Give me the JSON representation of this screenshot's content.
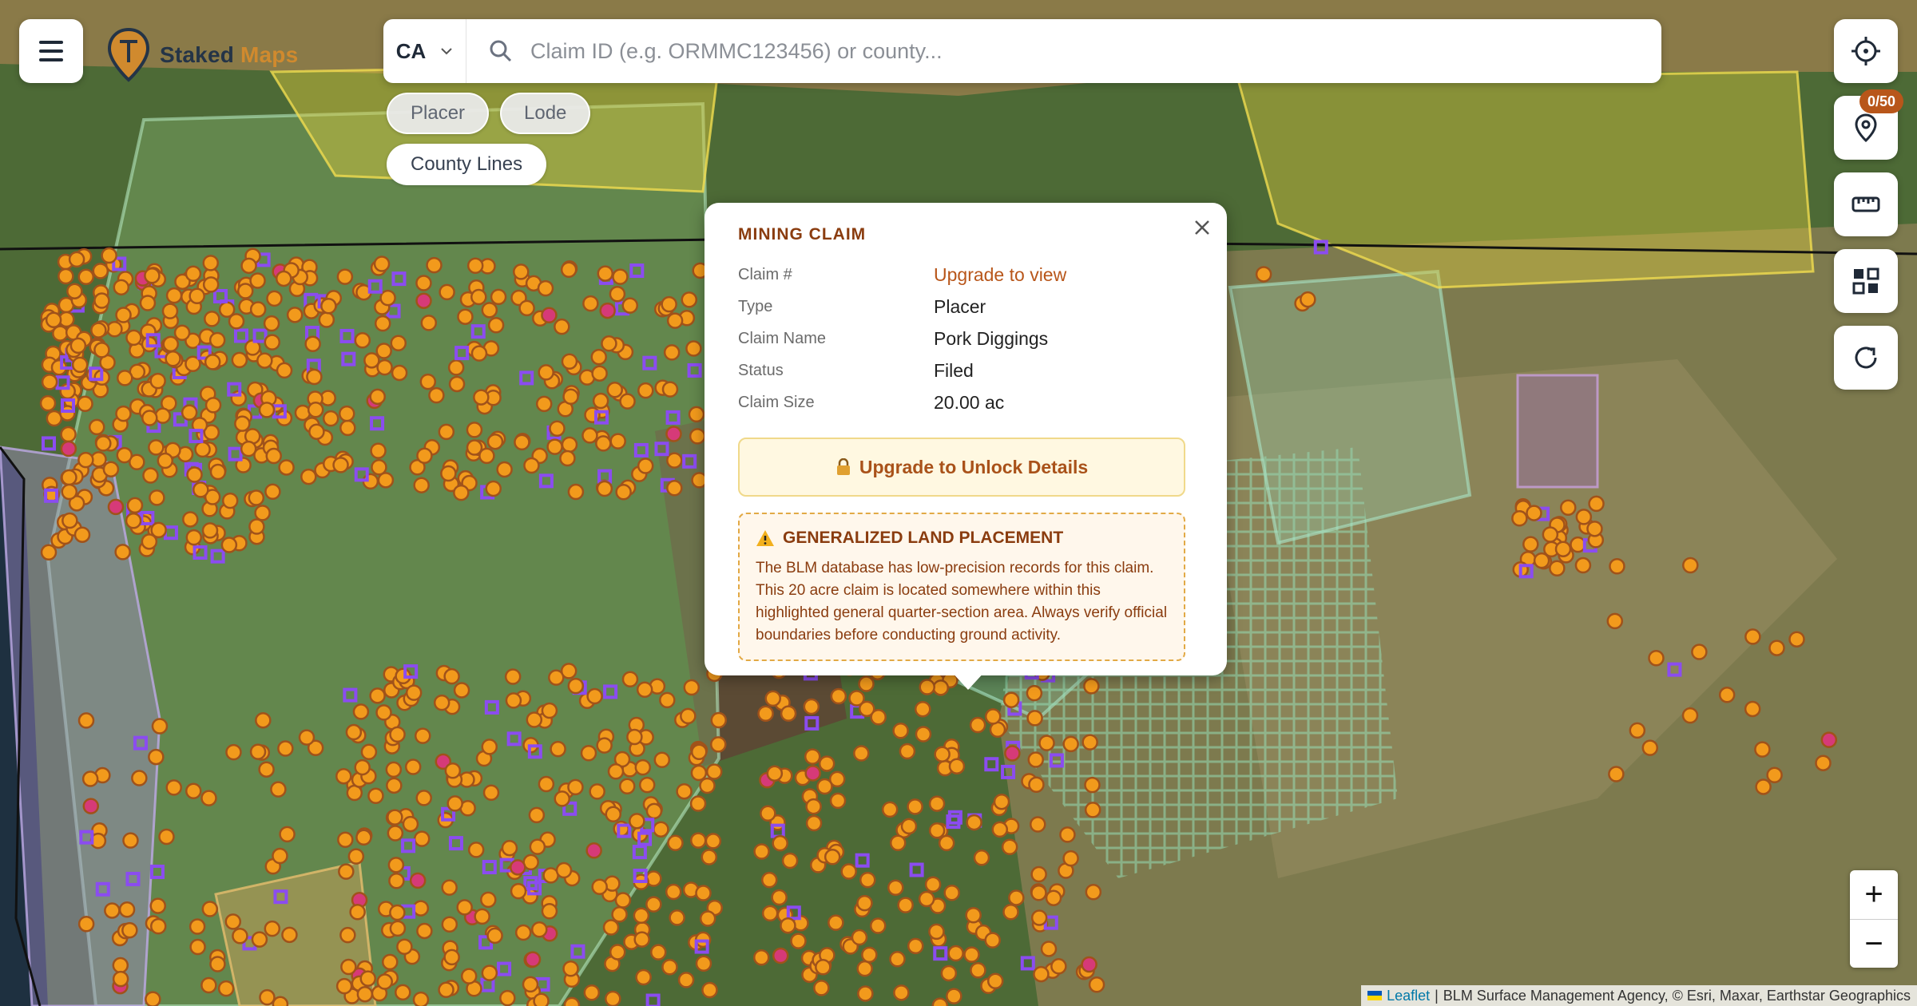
{
  "brand": {
    "word1": "Staked",
    "word2": "Maps"
  },
  "search": {
    "state": "CA",
    "placeholder": "Claim ID (e.g. ORMMC123456) or county..."
  },
  "filters": [
    {
      "label": "Placer"
    },
    {
      "label": "Lode"
    },
    {
      "label": "County Lines"
    }
  ],
  "tools": {
    "saved_badge": "0/50",
    "icons": [
      "locate-icon",
      "map-pin-icon",
      "ruler-icon",
      "layers-grid-icon",
      "refresh-icon"
    ]
  },
  "popup": {
    "title": "MINING CLAIM",
    "rows": [
      {
        "label": "Claim #",
        "value": "Upgrade to view"
      },
      {
        "label": "Type",
        "value": "Placer"
      },
      {
        "label": "Claim Name",
        "value": "Pork Diggings"
      },
      {
        "label": "Status",
        "value": "Filed"
      },
      {
        "label": "Claim Size",
        "value": "20.00 ac"
      }
    ],
    "unlock_label": "Upgrade to Unlock Details",
    "warning_title": "GENERALIZED LAND PLACEMENT",
    "warning_body": "The BLM database has low-precision records for this claim. This 20 acre claim is located somewhere within this highlighted general quarter-section area. Always verify official boundaries before conducting ground activity."
  },
  "zoom": {
    "in": "+",
    "out": "−"
  },
  "attribution": {
    "leaflet": "Leaflet",
    "sep": "|",
    "sources": "BLM Surface Management Agency, © Esri, Maxar, Earthstar Geographics"
  },
  "colors": {
    "claim_marker": "#f29a1c",
    "claim_marker_stroke": "#a0521a",
    "lode_marker": "#8b4cf0",
    "closed_marker": "#d63a78",
    "accent": "#b8561a"
  }
}
